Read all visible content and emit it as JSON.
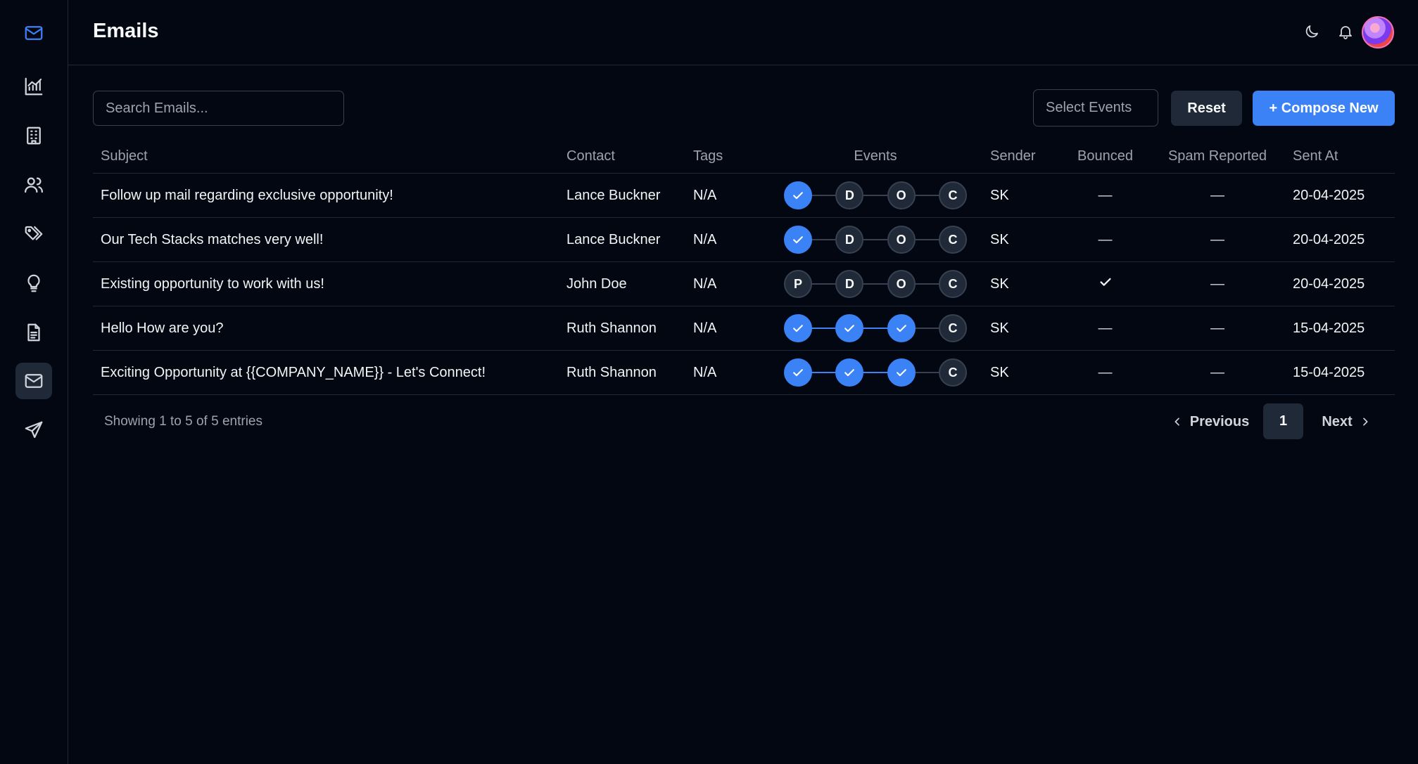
{
  "header": {
    "title": "Emails",
    "theme_icon": "moon-icon",
    "notification_icon": "bell-icon"
  },
  "sidebar": {
    "items": [
      {
        "icon": "mail-icon",
        "name": "brand-logo"
      },
      {
        "icon": "chart-icon",
        "name": "analytics"
      },
      {
        "icon": "building-icon",
        "name": "companies"
      },
      {
        "icon": "users-icon",
        "name": "contacts"
      },
      {
        "icon": "tags-icon",
        "name": "tags"
      },
      {
        "icon": "lightbulb-icon",
        "name": "ideas"
      },
      {
        "icon": "document-icon",
        "name": "templates"
      },
      {
        "icon": "mail-icon",
        "name": "emails",
        "active": true
      },
      {
        "icon": "send-icon",
        "name": "campaigns"
      }
    ]
  },
  "toolbar": {
    "search_placeholder": "Search Emails...",
    "select_events_label": "Select Events",
    "reset_label": "Reset",
    "compose_label": "+ Compose New"
  },
  "table": {
    "columns": [
      "Subject",
      "Contact",
      "Tags",
      "Events",
      "Sender",
      "Bounced",
      "Spam Reported",
      "Sent At"
    ],
    "rows": [
      {
        "subject": "Follow up mail regarding exclusive opportunity!",
        "contact": "Lance Buckner",
        "tags": "N/A",
        "events": [
          {
            "label": "P",
            "done": true
          },
          {
            "label": "D",
            "done": false
          },
          {
            "label": "O",
            "done": false
          },
          {
            "label": "C",
            "done": false
          }
        ],
        "sender": "SK",
        "bounced": "—",
        "spam": "—",
        "sent_at": "20-04-2025",
        "bounced_check": false
      },
      {
        "subject": "Our Tech Stacks matches very well!",
        "contact": "Lance Buckner",
        "tags": "N/A",
        "events": [
          {
            "label": "P",
            "done": true
          },
          {
            "label": "D",
            "done": false
          },
          {
            "label": "O",
            "done": false
          },
          {
            "label": "C",
            "done": false
          }
        ],
        "sender": "SK",
        "bounced": "—",
        "spam": "—",
        "sent_at": "20-04-2025",
        "bounced_check": false
      },
      {
        "subject": "Existing opportunity to work with us!",
        "contact": "John Doe",
        "tags": "N/A",
        "events": [
          {
            "label": "P",
            "done": false
          },
          {
            "label": "D",
            "done": false
          },
          {
            "label": "O",
            "done": false
          },
          {
            "label": "C",
            "done": false
          }
        ],
        "sender": "SK",
        "bounced": "",
        "spam": "—",
        "sent_at": "20-04-2025",
        "bounced_check": true
      },
      {
        "subject": "Hello How are you?",
        "contact": "Ruth Shannon",
        "tags": "N/A",
        "events": [
          {
            "label": "P",
            "done": true
          },
          {
            "label": "D",
            "done": true
          },
          {
            "label": "O",
            "done": true
          },
          {
            "label": "C",
            "done": false
          }
        ],
        "sender": "SK",
        "bounced": "—",
        "spam": "—",
        "sent_at": "15-04-2025",
        "bounced_check": false
      },
      {
        "subject": "Exciting Opportunity at {{COMPANY_NAME}} - Let's Connect!",
        "contact": "Ruth Shannon",
        "tags": "N/A",
        "events": [
          {
            "label": "P",
            "done": true
          },
          {
            "label": "D",
            "done": true
          },
          {
            "label": "O",
            "done": true
          },
          {
            "label": "C",
            "done": false
          }
        ],
        "sender": "SK",
        "bounced": "—",
        "spam": "—",
        "sent_at": "15-04-2025",
        "bounced_check": false
      }
    ]
  },
  "pagination": {
    "showing": "Showing 1 to 5 of 5 entries",
    "previous": "Previous",
    "page": "1",
    "next": "Next"
  },
  "colors": {
    "background": "#030712",
    "accent": "#3b82f6",
    "surface": "#1f2937"
  }
}
